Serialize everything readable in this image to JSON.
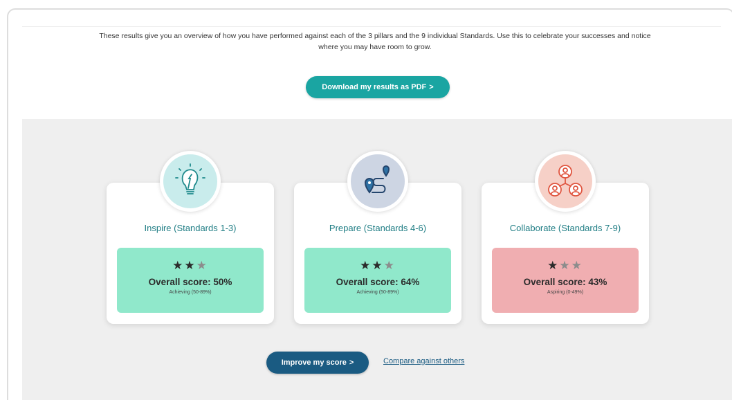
{
  "intro_text": "These results give you an overview of how you have performed against each of the 3 pillars and the 9 individual Standards. Use this to celebrate your successes and notice where you may have room to grow.",
  "download_button": {
    "label": "Download my results as PDF",
    "chevron": ">"
  },
  "colors": {
    "teal": "#1aa5a2",
    "navy": "#1a5b82",
    "title_text": "#1f7d84",
    "achieving_bg": "#90e8cb",
    "aspiring_bg": "#f0aeb1"
  },
  "pillars": [
    {
      "icon": "lightbulb-icon",
      "icon_bg": "#c9ecec",
      "title": "Inspire (Standards 1-3)",
      "stars_filled": 2,
      "stars_total": 3,
      "score_label": "Overall score: 50%",
      "band": "Achieving (50-89%)",
      "box_color": "#90e8cb"
    },
    {
      "icon": "route-icon",
      "icon_bg": "#cdd5e3",
      "title": "Prepare (Standards 4-6)",
      "stars_filled": 2,
      "stars_total": 3,
      "score_label": "Overall score: 64%",
      "band": "Achieving (50-89%)",
      "box_color": "#90e8cb"
    },
    {
      "icon": "network-people-icon",
      "icon_bg": "#f6d0c7",
      "title": "Collaborate (Standards 7-9)",
      "stars_filled": 1,
      "stars_total": 3,
      "score_label": "Overall score: 43%",
      "band": "Aspiring (0-49%)",
      "box_color": "#f0aeb1"
    }
  ],
  "improve_button": {
    "label": "Improve my score",
    "chevron": ">"
  },
  "compare_link": "Compare against others"
}
